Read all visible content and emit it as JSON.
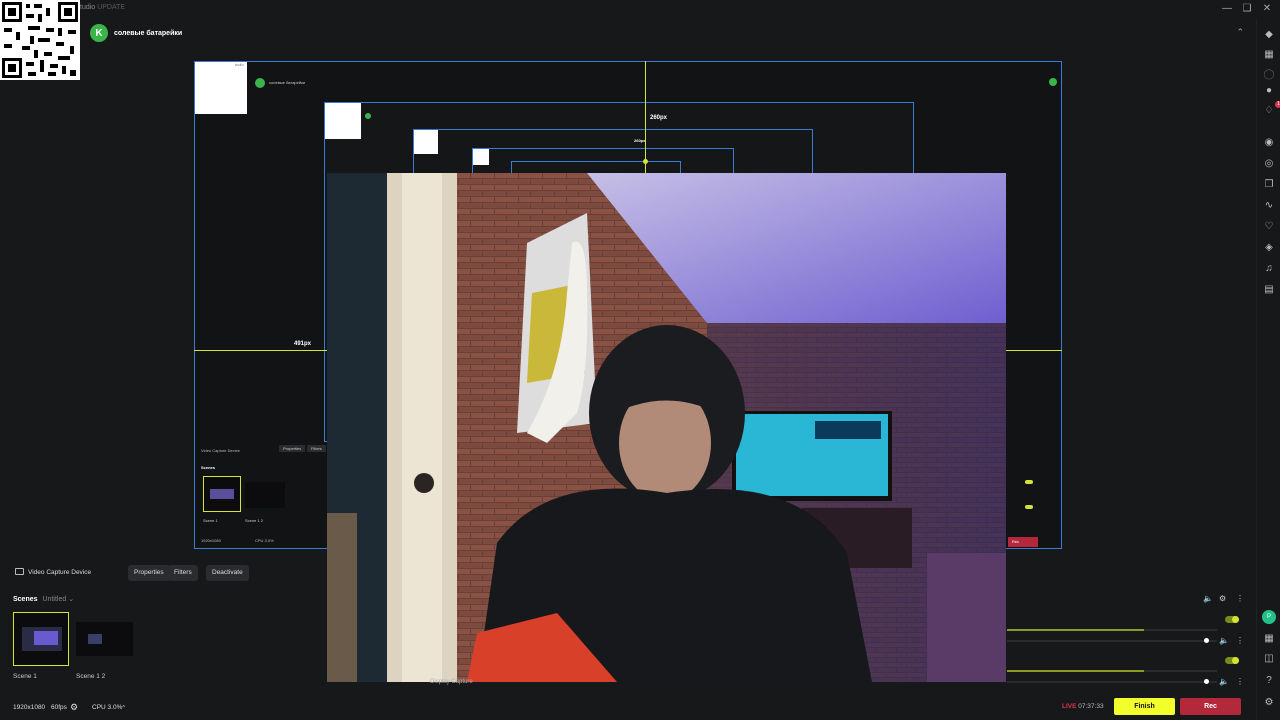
{
  "app": {
    "title": "tudio",
    "update_label": "UPDATE",
    "profile_name": "солевые батарейки"
  },
  "preview": {
    "guide_top_label": "260px",
    "guide_left_label": "491px",
    "nested_guide_label": "260px"
  },
  "source_bar": {
    "source_name": "Video Capture Device",
    "properties_label": "Properties",
    "filters_label": "Filters",
    "deactivate_label": "Deactivate"
  },
  "scenes": {
    "title": "Scenes",
    "collection": "Untitled",
    "items": [
      {
        "label": "Scene 1"
      },
      {
        "label": "Scene 1 2"
      }
    ]
  },
  "mixer": {
    "tracks": [
      {
        "level": 0.65,
        "volume": 0.95
      },
      {
        "level": 0.65,
        "volume": 0.95
      }
    ]
  },
  "footer": {
    "resolution": "1920x1080",
    "fps": "60fps",
    "cpu": "CPU 3.0%",
    "live_label": "LIVE",
    "live_time": "07:37:33",
    "finish_label": "Finish",
    "rec_label": "Rec"
  },
  "webcam_overlay": {
    "display_capture_label": "Display Capture"
  },
  "icons": [
    "close-icon",
    "maximize-icon",
    "minimize-icon",
    "collapse-icon",
    "studio-logo-icon",
    "layout-icon",
    "chat-icon",
    "notifications-icon",
    "camera-icon",
    "record-icon",
    "scenes-icon",
    "link-icon",
    "heart-icon",
    "tip-icon",
    "music-icon",
    "trash-icon",
    "help-icon",
    "settings-icon"
  ],
  "colors": {
    "accent": "#d4e33a",
    "finish": "#f2ff2a",
    "rec": "#b3283b",
    "live": "#e0334f",
    "frame": "#3a7bd5"
  }
}
